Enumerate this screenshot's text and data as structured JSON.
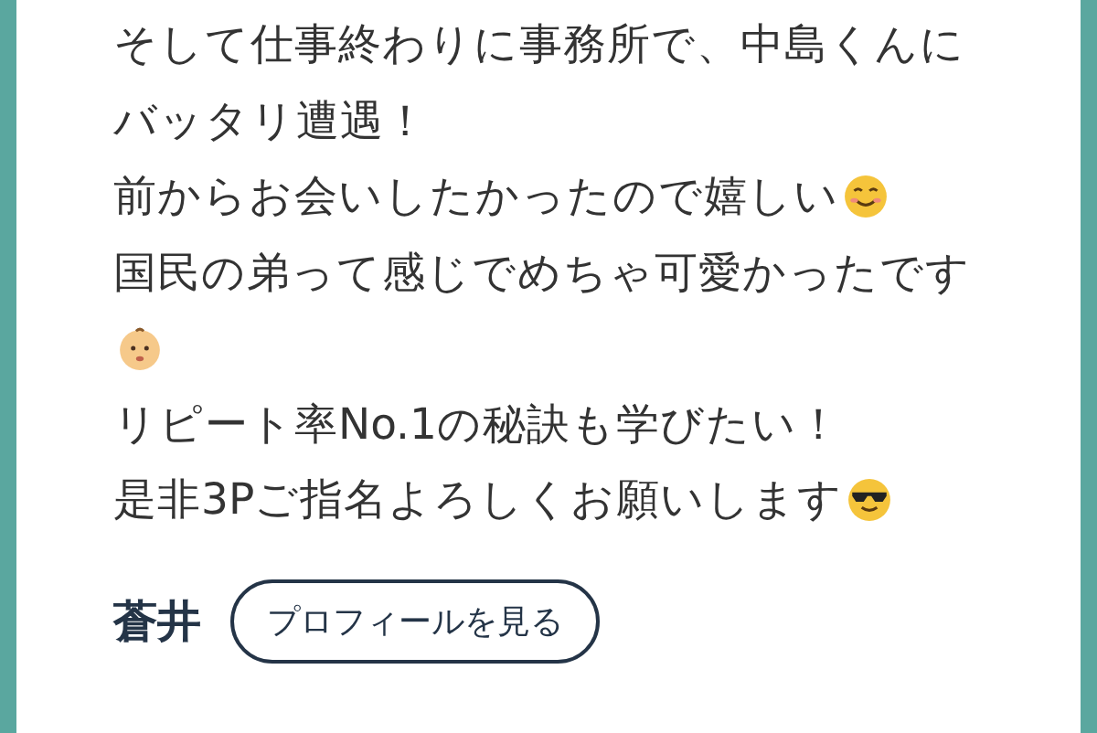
{
  "message": {
    "lines": [
      "そして仕事終わりに事務所で、中島くんに",
      "バッタリ遭遇！",
      "前からお会いしたかったので嬉しい",
      "国民の弟って感じでめちゃ可愛かったです",
      "リピート率No.1の秘訣も学びたい！",
      "是非3Pご指名よろしくお願いします"
    ]
  },
  "author": {
    "name": "蒼井",
    "profile_button": "プロフィールを見る"
  }
}
